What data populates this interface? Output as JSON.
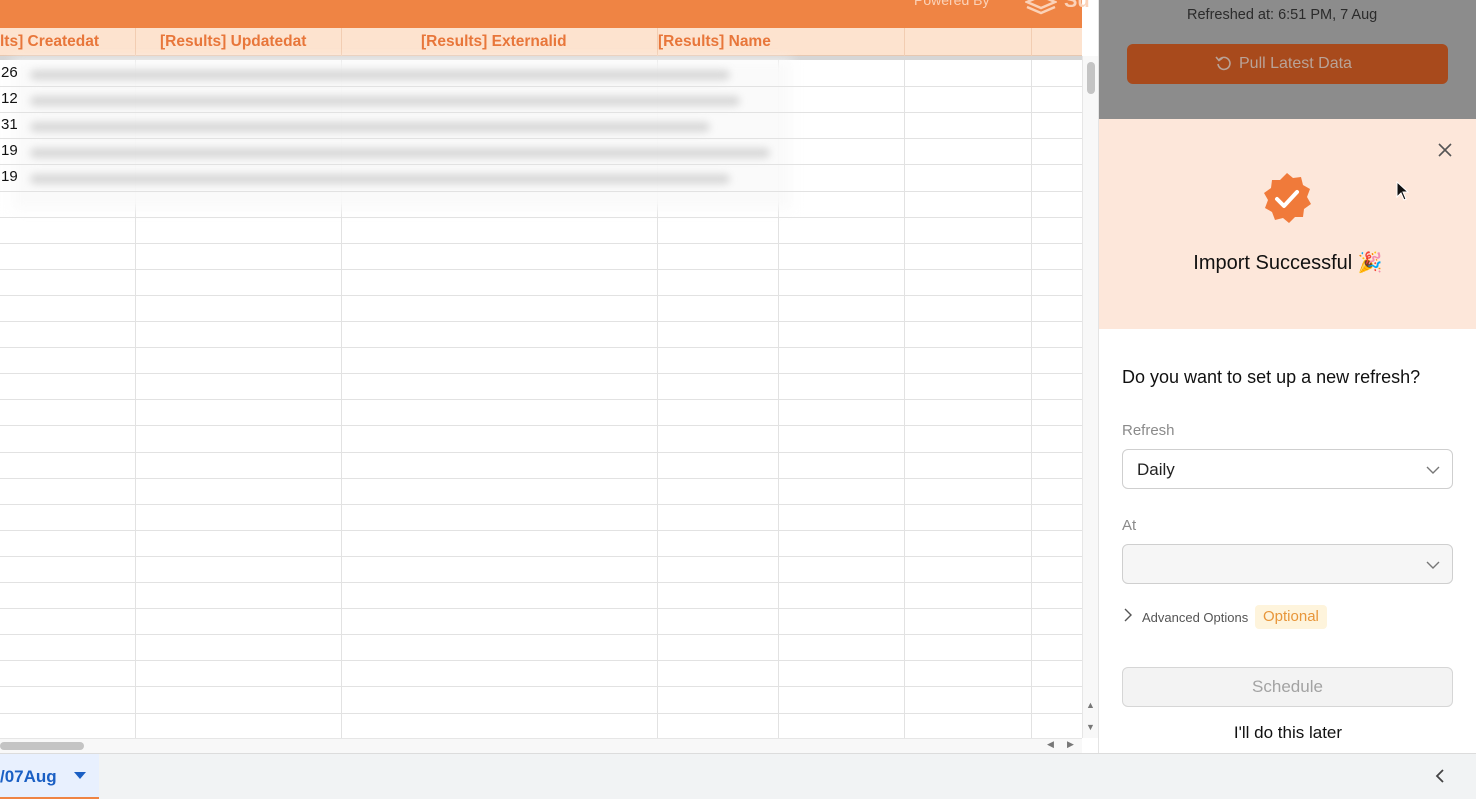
{
  "banner": {
    "powered_by": "Powered By",
    "logo_text": "Su"
  },
  "sheet": {
    "columns": [
      "lts] Createdat",
      "[Results] Updatedat",
      "[Results] Externalid",
      "[Results] Name"
    ],
    "row_prefixes": [
      "26",
      "12",
      "31",
      "19",
      "19"
    ],
    "active_tab": "/07Aug"
  },
  "panel": {
    "refreshed_at": "Refreshed at: 6:51 PM, 7 Aug",
    "pull_button": "Pull Latest Data",
    "success_title": "Import Successful 🎉",
    "question": "Do you want to set up a new refresh?",
    "refresh_label": "Refresh",
    "refresh_value": "Daily",
    "at_label": "At",
    "at_value": "",
    "advanced_label": "Advanced Options",
    "advanced_badge": "Optional",
    "schedule_button": "Schedule",
    "later_link": "I'll do this later"
  },
  "colors": {
    "brand_orange": "#ef8444",
    "header_bg": "#fde3cf",
    "success_bg": "#fde7da",
    "badge_orange": "#f07a3a",
    "tab_blue": "#1a5fc4"
  },
  "icons": [
    "logo-icon",
    "refresh-icon",
    "close-icon",
    "verified-badge-icon",
    "cursor-icon",
    "chevron-down-icon",
    "chevron-right-icon",
    "chevron-left-icon",
    "dropdown-caret-icon"
  ]
}
